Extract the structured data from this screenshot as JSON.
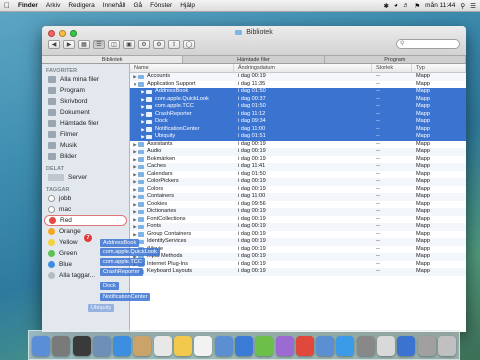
{
  "menubar": {
    "app": "Finder",
    "menus": [
      "Arkiv",
      "Redigera",
      "Innehåll",
      "Gå",
      "Fönster",
      "Hjälp"
    ],
    "clock": "mån 11:44"
  },
  "window": {
    "title": "Bibliotek",
    "tabs": [
      "Bibliotek",
      "Hämtade filer",
      "Program"
    ]
  },
  "sidebar": {
    "sections": [
      {
        "header": "FAVORITER",
        "items": [
          "Alla mina filer",
          "Program",
          "Skrivbord",
          "Dokument",
          "Hämtade filer",
          "Filmer",
          "Musik",
          "Bilder"
        ]
      },
      {
        "header": "DELAT",
        "items": [
          "Server"
        ]
      },
      {
        "header": "TAGGAR",
        "items": [
          "jobb",
          "mac",
          "Red",
          "Orange",
          "Yellow",
          "Green",
          "Blue",
          "Alla taggar..."
        ]
      }
    ],
    "tag_colors": [
      "#ffffff",
      "#ffffff",
      "#ffffff",
      "#f5a623",
      "#f3d23c",
      "#5cc254",
      "#3c8fe0",
      "#9aa6b2"
    ]
  },
  "list": {
    "columns": [
      "Name",
      "Ändringsdatum",
      "Storlek",
      "Typ"
    ],
    "rows": [
      {
        "name": "Accounts",
        "date": "i dag 00:19",
        "size": "--",
        "kind": "Mapp",
        "level": 0,
        "open": false,
        "sel": false
      },
      {
        "name": "Application Support",
        "date": "i dag 11:35",
        "size": "--",
        "kind": "Mapp",
        "level": 0,
        "open": true,
        "sel": false
      },
      {
        "name": "AddressBook",
        "date": "i dag 01:50",
        "size": "--",
        "kind": "Mapp",
        "level": 1,
        "open": false,
        "sel": true
      },
      {
        "name": "com.apple.QuickLook",
        "date": "i dag 00:37",
        "size": "--",
        "kind": "Mapp",
        "level": 1,
        "open": false,
        "sel": true
      },
      {
        "name": "com.apple.TCC",
        "date": "i dag 01:50",
        "size": "--",
        "kind": "Mapp",
        "level": 1,
        "open": false,
        "sel": true
      },
      {
        "name": "CrashReporter",
        "date": "i dag 11:12",
        "size": "--",
        "kind": "Mapp",
        "level": 1,
        "open": false,
        "sel": true
      },
      {
        "name": "Dock",
        "date": "i dag 09:34",
        "size": "--",
        "kind": "Mapp",
        "level": 1,
        "open": false,
        "sel": true
      },
      {
        "name": "NotificationCenter",
        "date": "i dag 11:00",
        "size": "--",
        "kind": "Mapp",
        "level": 1,
        "open": false,
        "sel": true
      },
      {
        "name": "Ubiquity",
        "date": "i dag 01:51",
        "size": "--",
        "kind": "Mapp",
        "level": 1,
        "open": false,
        "sel": true
      },
      {
        "name": "Assistants",
        "date": "i dag 00:19",
        "size": "--",
        "kind": "Mapp",
        "level": 0,
        "open": false,
        "sel": false
      },
      {
        "name": "Audio",
        "date": "i dag 00:19",
        "size": "--",
        "kind": "Mapp",
        "level": 0,
        "open": false,
        "sel": false
      },
      {
        "name": "Bokmärken",
        "date": "i dag 00:19",
        "size": "--",
        "kind": "Mapp",
        "level": 0,
        "open": false,
        "sel": false
      },
      {
        "name": "Caches",
        "date": "i dag 11:41",
        "size": "--",
        "kind": "Mapp",
        "level": 0,
        "open": false,
        "sel": false
      },
      {
        "name": "Calendars",
        "date": "i dag 01:50",
        "size": "--",
        "kind": "Mapp",
        "level": 0,
        "open": false,
        "sel": false
      },
      {
        "name": "ColorPickers",
        "date": "i dag 00:19",
        "size": "--",
        "kind": "Mapp",
        "level": 0,
        "open": false,
        "sel": false
      },
      {
        "name": "Colors",
        "date": "i dag 00:19",
        "size": "--",
        "kind": "Mapp",
        "level": 0,
        "open": false,
        "sel": false
      },
      {
        "name": "Containers",
        "date": "i dag 11:00",
        "size": "--",
        "kind": "Mapp",
        "level": 0,
        "open": false,
        "sel": false
      },
      {
        "name": "Cookies",
        "date": "i dag 09:56",
        "size": "--",
        "kind": "Mapp",
        "level": 0,
        "open": false,
        "sel": false
      },
      {
        "name": "Dictionaries",
        "date": "i dag 00:19",
        "size": "--",
        "kind": "Mapp",
        "level": 0,
        "open": false,
        "sel": false
      },
      {
        "name": "FontCollections",
        "date": "i dag 00:19",
        "size": "--",
        "kind": "Mapp",
        "level": 0,
        "open": false,
        "sel": false
      },
      {
        "name": "Fonts",
        "date": "i dag 00:19",
        "size": "--",
        "kind": "Mapp",
        "level": 0,
        "open": false,
        "sel": false
      },
      {
        "name": "Group Containers",
        "date": "i dag 00:19",
        "size": "--",
        "kind": "Mapp",
        "level": 0,
        "open": false,
        "sel": false
      },
      {
        "name": "IdentityServices",
        "date": "i dag 00:19",
        "size": "--",
        "kind": "Mapp",
        "level": 0,
        "open": false,
        "sel": false
      },
      {
        "name": "iMovie",
        "date": "i dag 00:19",
        "size": "--",
        "kind": "Mapp",
        "level": 0,
        "open": false,
        "sel": false
      },
      {
        "name": "Input Methods",
        "date": "i dag 00:19",
        "size": "--",
        "kind": "Mapp",
        "level": 0,
        "open": false,
        "sel": false
      },
      {
        "name": "Internet Plug-Ins",
        "date": "i dag 00:19",
        "size": "--",
        "kind": "Mapp",
        "level": 0,
        "open": false,
        "sel": false
      },
      {
        "name": "Keyboard Layouts",
        "date": "i dag 00:19",
        "size": "--",
        "kind": "Mapp",
        "level": 0,
        "open": false,
        "sel": false
      }
    ]
  },
  "drag": {
    "badge": "7",
    "items": [
      "AddressBook",
      "com.apple.QuickLook",
      "com.apple.TCC",
      "CrashReporter",
      "Dock",
      "NotificationCenter",
      "Ubiquity"
    ]
  },
  "dock": {
    "icon_colors": [
      "#5a8fd8",
      "#7a7a7a",
      "#3a3a3a",
      "#6e8fb8",
      "#3b8ee0",
      "#c9a36a",
      "#e8e8e8",
      "#f2c94c",
      "#f2f2f2",
      "#5b8fd1",
      "#3a7bd5",
      "#6cc04a",
      "#9b6ad3",
      "#e0483b",
      "#5b8fd1",
      "#3b9be8",
      "#888888",
      "#d9d9d9",
      "#3b73d1",
      "#a0a0a0",
      "#c0c0c0"
    ],
    "icons": [
      "finder-icon",
      "launchpad-icon",
      "mission-control-icon",
      "mail-stamp-icon",
      "safari-icon",
      "contacts-icon",
      "calendar-icon",
      "notes-icon",
      "reminders-icon",
      "maps-icon",
      "messages-icon",
      "facetime-icon",
      "itunes-icon",
      "photo-booth-icon",
      "iphoto-icon",
      "app-store-icon",
      "system-preferences-icon",
      "preview-icon",
      "downloads-icon",
      "folder-icon",
      "trash-icon"
    ]
  }
}
